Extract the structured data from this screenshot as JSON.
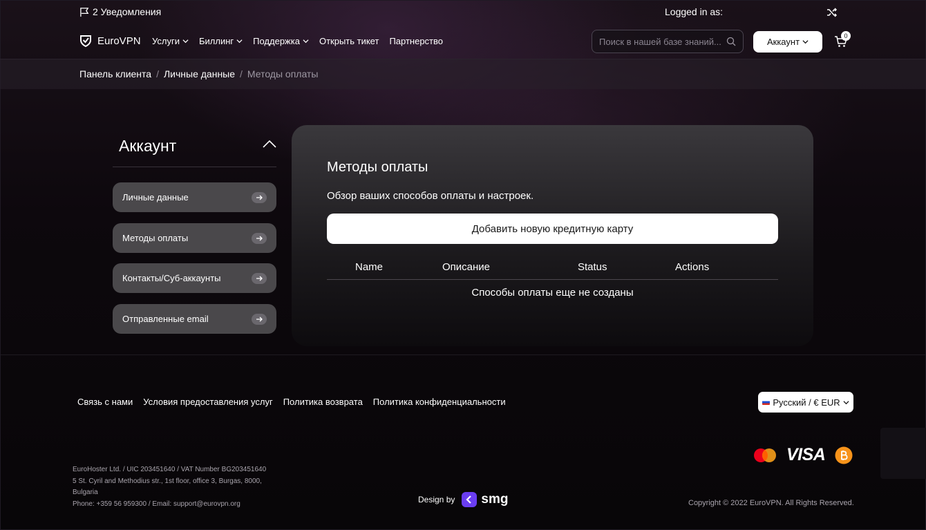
{
  "topbar": {
    "notifications": "2 Уведомления",
    "logged_in": "Logged in as:"
  },
  "nav": {
    "brand": "EuroVPN",
    "items": [
      "Услуги",
      "Биллинг",
      "Поддержка",
      "Открыть тикет",
      "Партнерство"
    ],
    "search_placeholder": "Поиск в нашей базе знаний...",
    "account_label": "Аккаунт",
    "cart_count": "0"
  },
  "breadcrumb": {
    "items": [
      "Панель клиента",
      "Личные данные"
    ],
    "current": "Методы оплаты",
    "separator": "/"
  },
  "sidebar": {
    "title": "Аккаунт",
    "items": [
      {
        "label": "Личные данные"
      },
      {
        "label": "Методы оплаты"
      },
      {
        "label": "Контакты/Суб-аккаунты"
      },
      {
        "label": "Отправленные email"
      }
    ]
  },
  "main": {
    "title": "Методы оплаты",
    "subtitle": "Обзор ваших способов оплаты и настроек.",
    "add_button": "Добавить новую кредитную карту",
    "columns": [
      "Name",
      "Описание",
      "Status",
      "Actions"
    ],
    "empty_message": "Способы оплаты еще не созданы"
  },
  "footer": {
    "links": [
      "Связь с нами",
      "Условия предоставления услуг",
      "Политика возврата",
      "Политика конфиденциальности"
    ],
    "language": "Русский / € EUR",
    "payment_icons": [
      "mastercard-icon",
      "visa-icon",
      "bitcoin-icon"
    ],
    "visa_text": "VISA",
    "company_lines": [
      "EuroHoster Ltd. / UIC 203451640 / VAT Number BG203451640",
      "5 St. Cyril and Methodius str., 1st floor, office 3, Burgas, 8000,",
      "Bulgaria",
      "Phone: +359 56 959300 / Email: support@eurovpn.org"
    ],
    "design_by": "Design by",
    "design_brand": "smg",
    "copyright": "Copyright © 2022 EuroVPN. All Rights Reserved."
  },
  "colors": {
    "background": "#0a070b",
    "button_light": "#ffffff",
    "sidebar_item": "#4a484b",
    "design_accent": "#6a3df2",
    "bitcoin": "#f7931a"
  }
}
